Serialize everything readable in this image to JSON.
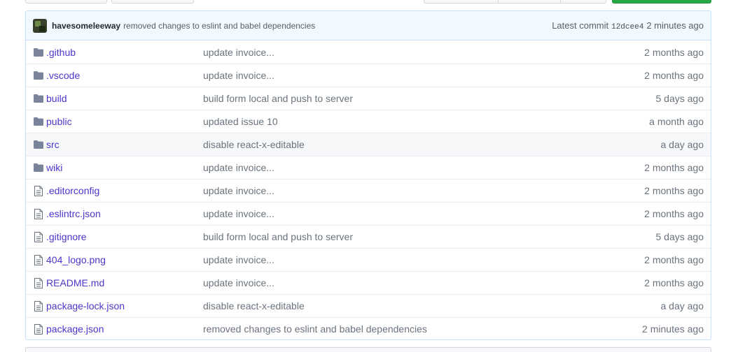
{
  "commit": {
    "author": "havesomeleeway",
    "message": "removed changes to eslint and babel dependencies",
    "latest_label": "Latest commit",
    "sha": "12dcee4",
    "age": "2 minutes ago"
  },
  "files": [
    {
      "name": ".github",
      "type": "folder",
      "message": "update invoice...",
      "age": "2 months ago"
    },
    {
      "name": ".vscode",
      "type": "folder",
      "message": "update invoice...",
      "age": "2 months ago"
    },
    {
      "name": "build",
      "type": "folder",
      "message": "build form local and push to server",
      "age": "5 days ago"
    },
    {
      "name": "public",
      "type": "folder",
      "message": "updated issue 10",
      "age": "a month ago"
    },
    {
      "name": "src",
      "type": "folder",
      "message": "disable react-x-editable",
      "age": "a day ago"
    },
    {
      "name": "wiki",
      "type": "folder",
      "message": "update invoice...",
      "age": "2 months ago"
    },
    {
      "name": ".editorconfig",
      "type": "file",
      "message": "update invoice...",
      "age": "2 months ago"
    },
    {
      "name": ".eslintrc.json",
      "type": "file",
      "message": "update invoice...",
      "age": "2 months ago"
    },
    {
      "name": ".gitignore",
      "type": "file",
      "message": "build form local and push to server",
      "age": "5 days ago"
    },
    {
      "name": "404_logo.png",
      "type": "file",
      "message": "update invoice...",
      "age": "2 months ago"
    },
    {
      "name": "README.md",
      "type": "file",
      "message": "update invoice...",
      "age": "2 months ago"
    },
    {
      "name": "package-lock.json",
      "type": "file",
      "message": "disable react-x-editable",
      "age": "a day ago"
    },
    {
      "name": "package.json",
      "type": "file",
      "message": "removed changes to eslint and babel dependencies",
      "age": "2 minutes ago"
    }
  ],
  "icons": {
    "folder": "folder-icon",
    "file": "file-icon"
  },
  "colors": {
    "link": "#4a36c9",
    "commit_bar": "#f1f8ff",
    "folder_icon": "#79849a",
    "green_button": "#28a745"
  }
}
